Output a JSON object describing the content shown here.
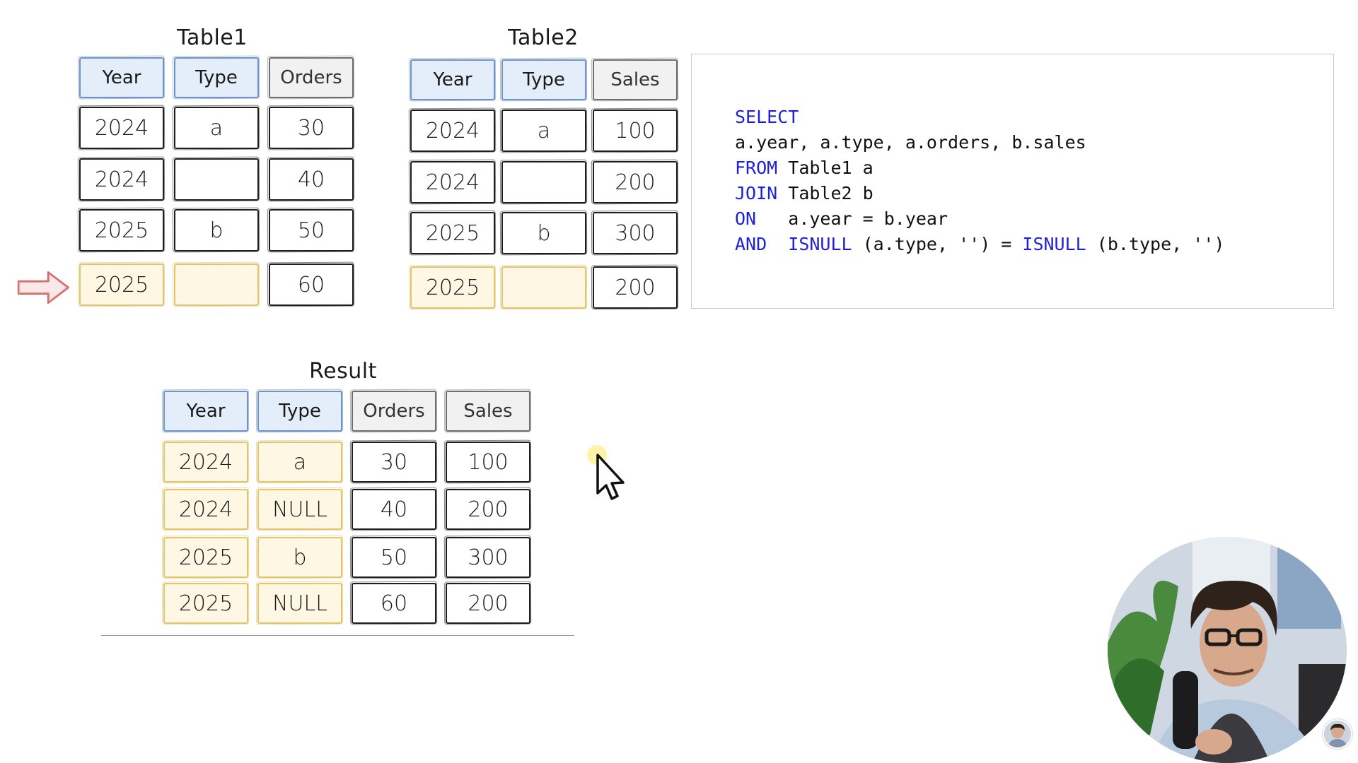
{
  "table1": {
    "title": "Table1",
    "headers": [
      "Year",
      "Type",
      "Orders"
    ],
    "rows": [
      [
        "2024",
        "a",
        "30"
      ],
      [
        "2024",
        "",
        "40"
      ],
      [
        "2025",
        "b",
        "50"
      ],
      [
        "2025",
        "",
        "60"
      ]
    ]
  },
  "table2": {
    "title": "Table2",
    "headers": [
      "Year",
      "Type",
      "Sales"
    ],
    "rows": [
      [
        "2024",
        "a",
        "100"
      ],
      [
        "2024",
        "",
        "200"
      ],
      [
        "2025",
        "b",
        "300"
      ],
      [
        "2025",
        "",
        "200"
      ]
    ]
  },
  "result": {
    "title": "Result",
    "headers": [
      "Year",
      "Type",
      "Orders",
      "Sales"
    ],
    "rows": [
      [
        "2024",
        "a",
        "30",
        "100"
      ],
      [
        "2024",
        "NULL",
        "40",
        "200"
      ],
      [
        "2025",
        "b",
        "50",
        "300"
      ],
      [
        "2025",
        "NULL",
        "60",
        "200"
      ]
    ]
  },
  "sql": {
    "lines": [
      [
        {
          "t": "SELECT",
          "kw": true
        }
      ],
      [
        {
          "t": "a.year, a.type, a.orders, b.sales",
          "kw": false
        }
      ],
      [
        {
          "t": "FROM",
          "kw": true
        },
        {
          "t": " Table1 a",
          "kw": false
        }
      ],
      [
        {
          "t": "JOIN",
          "kw": true
        },
        {
          "t": " Table2 b",
          "kw": false
        }
      ],
      [
        {
          "t": "ON",
          "kw": true
        },
        {
          "t": "   a.year = b.year",
          "kw": false
        }
      ],
      [
        {
          "t": "AND",
          "kw": true
        },
        {
          "t": "  ",
          "kw": false
        },
        {
          "t": "ISNULL",
          "kw": true
        },
        {
          "t": " (a.type, '') = ",
          "kw": false
        },
        {
          "t": "ISNULL",
          "kw": true
        },
        {
          "t": " (b.type, '')",
          "kw": false
        }
      ]
    ]
  },
  "colors": {
    "header_blue_fill": "#e3eefa",
    "header_blue_border": "#6f93c8",
    "highlight_yellow_fill": "#fdf7e4",
    "highlight_yellow_border": "#e2c46d",
    "arrow": "#d46a6a",
    "sql_keyword": "#1f1fd6"
  },
  "icons": {
    "arrow": "right-arrow-icon",
    "cursor": "mouse-pointer-icon"
  }
}
